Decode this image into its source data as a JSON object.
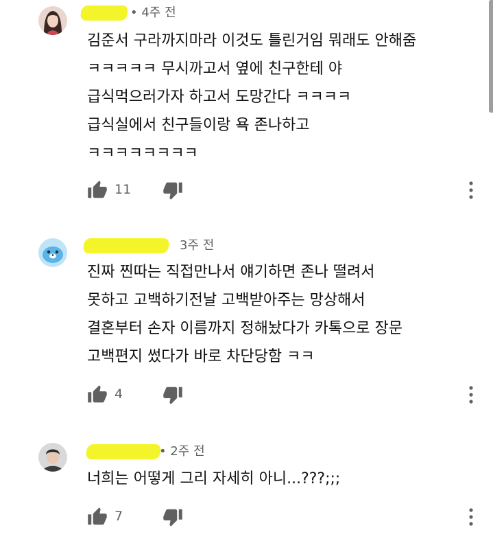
{
  "comments": [
    {
      "time": "4주 전",
      "lines": [
        "김준서 구라까지마라 이것도 틀린거임 뭐래도 안해줌",
        "ㅋㅋㅋㅋㅋ 무시까고서 옆에 친구한테 야",
        "급식먹으러가자 하고서 도망간다 ㅋㅋㅋㅋ",
        "급식실에서 친구들이랑 욕 존나하고",
        "ㅋㅋㅋㅋㅋㅋㅋㅋ"
      ],
      "likes": "11",
      "avatar": "profile-photo-woman"
    },
    {
      "time": "3주 전",
      "lines": [
        "진짜 찐따는 직접만나서 얘기하면 존나 떨려서",
        "못하고 고백하기전날 고백받아주는 망상해서",
        "결혼부터 손자 이름까지 정해놨다가 카톡으로 장문",
        "고백편지 썼다가 바로 차단당함 ㅋㅋ"
      ],
      "likes": "4",
      "avatar": "blue-seal-cartoon"
    },
    {
      "time": "2주 전",
      "lines": [
        "너희는 어떻게 그리 자세히 아니...???;;;"
      ],
      "likes": "7",
      "avatar": "profile-photo-man"
    }
  ],
  "icons": {
    "like": "thumbs-up-icon",
    "dislike": "thumbs-down-icon",
    "more": "more-vert-icon"
  },
  "colors": {
    "redaction": "#f3f52a",
    "meta_text": "#606060",
    "icon": "#606060"
  }
}
